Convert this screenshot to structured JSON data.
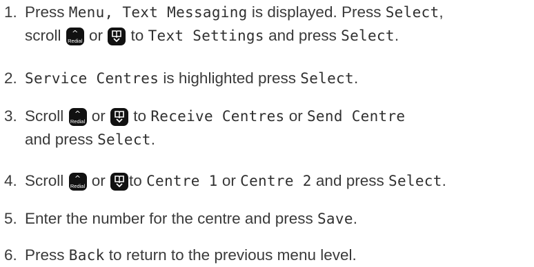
{
  "steps": [
    {
      "num": "1.",
      "l1": [
        "Press ",
        "Menu, Text Messaging",
        " is displayed. Press ",
        "Select",
        ","
      ],
      "l2": [
        "scroll ",
        " or ",
        " to ",
        "Text Settings",
        " and press ",
        "Select",
        "."
      ]
    },
    {
      "num": "2.",
      "l1": [
        "Service Centres",
        " is highlighted press ",
        "Select",
        "."
      ]
    },
    {
      "num": "3.",
      "l1": [
        "Scroll ",
        " or ",
        " to ",
        "Receive Centres",
        " or ",
        "Send Centre"
      ],
      "l2": [
        "and press ",
        "Select",
        "."
      ]
    },
    {
      "num": "4.",
      "l1": [
        "Scroll ",
        " or ",
        "to ",
        "Centre 1",
        " or ",
        "Centre 2",
        " and press ",
        "Select",
        "."
      ]
    },
    {
      "num": "5.",
      "l1": [
        "Enter the number for the centre and press ",
        "Save",
        "."
      ]
    },
    {
      "num": "6.",
      "l1": [
        "Press ",
        "Back",
        " to return to the previous menu level."
      ]
    }
  ],
  "icons": {
    "redial_label": "Redial",
    "redial_icon": "redial-up-key-icon",
    "phonebook_icon": "phonebook-down-key-icon"
  }
}
